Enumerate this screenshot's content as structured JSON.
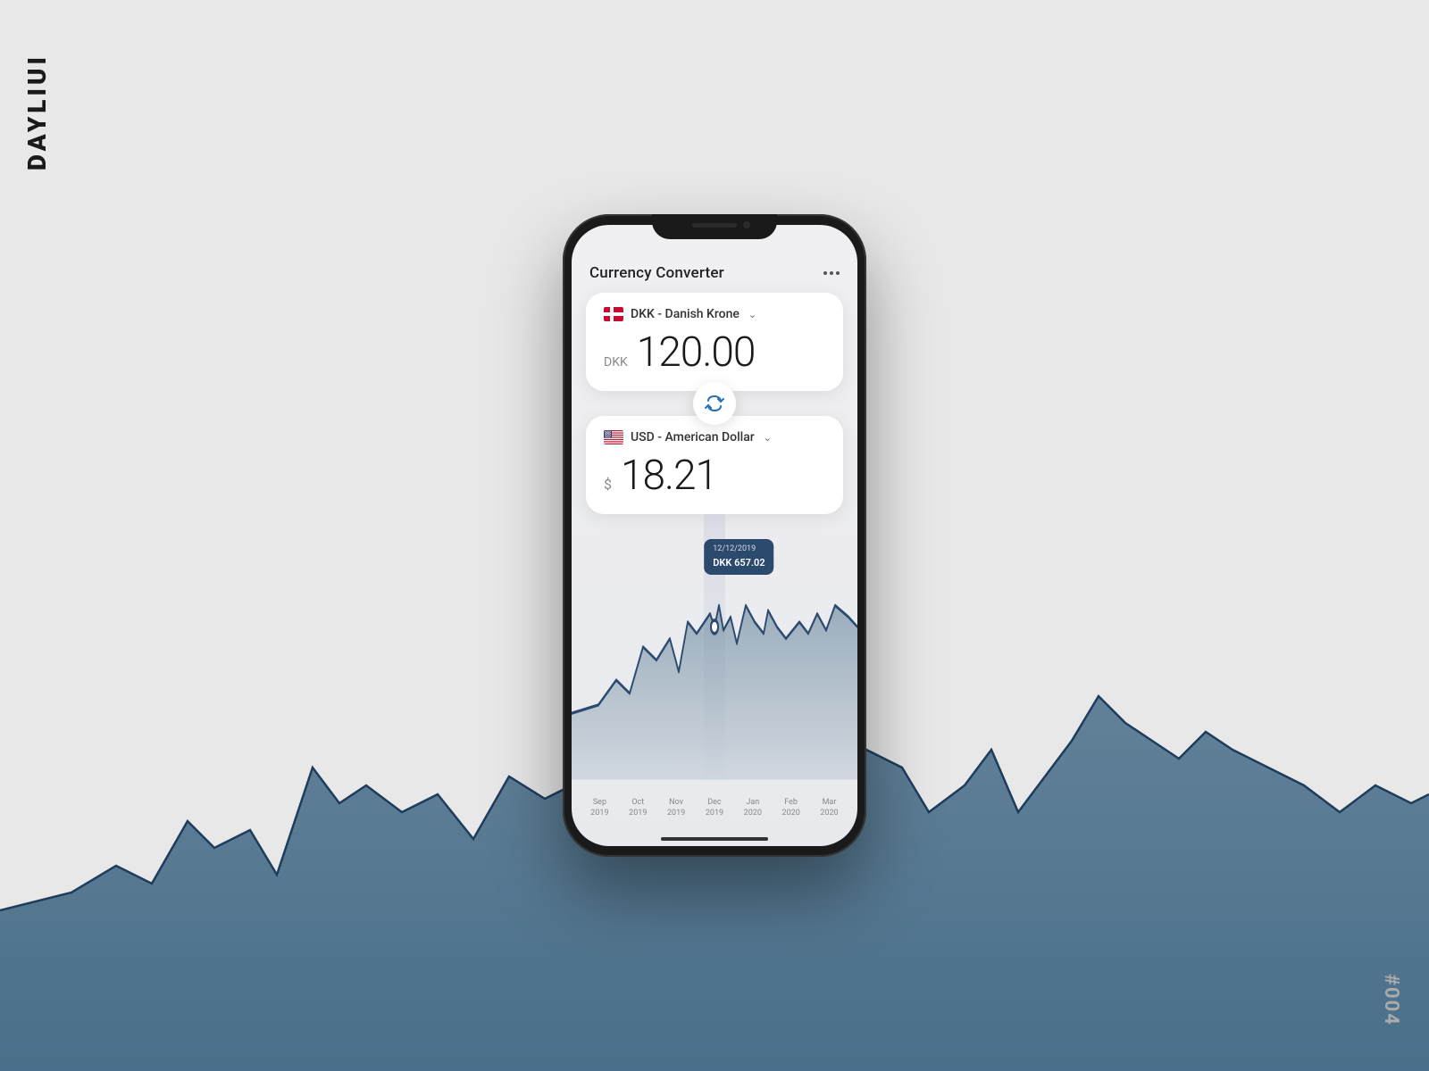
{
  "brand": {
    "name": "DAYLIUI",
    "corner_number": "#004"
  },
  "app": {
    "title": "Currency Converter",
    "header_dots": [
      "dot1",
      "dot2",
      "dot3"
    ]
  },
  "from_currency": {
    "flag": "🇩🇰",
    "label": "DKK - Danish Krone",
    "code": "DKK",
    "amount": "120.00"
  },
  "to_currency": {
    "flag": "🇺🇸",
    "label": "USD - American Dollar",
    "symbol": "$",
    "amount": "18.21"
  },
  "chart": {
    "tooltip_date": "12/12/2019",
    "tooltip_value": "DKK 657.02",
    "x_labels": [
      {
        "line1": "Sep",
        "line2": "2019"
      },
      {
        "line1": "Oct",
        "line2": "2019"
      },
      {
        "line1": "Nov",
        "line2": "2019"
      },
      {
        "line1": "Dec",
        "line2": "2019"
      },
      {
        "line1": "Jan",
        "line2": "2020"
      },
      {
        "line1": "Feb",
        "line2": "2020"
      },
      {
        "line1": "Mar",
        "line2": "2020"
      }
    ]
  },
  "swap_button_label": "swap",
  "chevron": "∨"
}
